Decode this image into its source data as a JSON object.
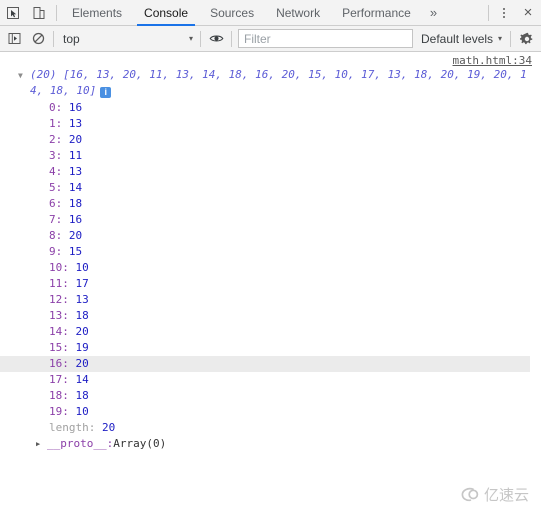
{
  "tabbar": {
    "inspect_icon": "inspect-element-icon",
    "device_icon": "device-toolbar-icon",
    "tabs": [
      {
        "label": "Elements",
        "selected": false
      },
      {
        "label": "Console",
        "selected": true
      },
      {
        "label": "Sources",
        "selected": false
      },
      {
        "label": "Network",
        "selected": false
      },
      {
        "label": "Performance",
        "selected": false
      }
    ],
    "overflow_label": "»",
    "more_icon": "more-options-icon",
    "close_label": "×"
  },
  "toolbar": {
    "sidebar_icon": "console-sidebar-icon",
    "clear_icon": "clear-console-icon",
    "context_value": "top",
    "context_caret": "▾",
    "eye_icon": "live-expression-eye-icon",
    "filter_placeholder": "Filter",
    "filter_value": "",
    "levels_label": "Default levels",
    "levels_caret": "▾",
    "gear_icon": "settings-gear-icon"
  },
  "console": {
    "source_link": "math.html:34",
    "preview": "(20) [16, 13, 20, 11, 13, 14, 18, 16, 20, 15, 10, 17, 13, 18, 20, 19, 20, 14, 18, 10]",
    "info_badge": "i",
    "properties": [
      {
        "key": "0:",
        "value": "16",
        "highlighted": false
      },
      {
        "key": "1:",
        "value": "13",
        "highlighted": false
      },
      {
        "key": "2:",
        "value": "20",
        "highlighted": false
      },
      {
        "key": "3:",
        "value": "11",
        "highlighted": false
      },
      {
        "key": "4:",
        "value": "13",
        "highlighted": false
      },
      {
        "key": "5:",
        "value": "14",
        "highlighted": false
      },
      {
        "key": "6:",
        "value": "18",
        "highlighted": false
      },
      {
        "key": "7:",
        "value": "16",
        "highlighted": false
      },
      {
        "key": "8:",
        "value": "20",
        "highlighted": false
      },
      {
        "key": "9:",
        "value": "15",
        "highlighted": false
      },
      {
        "key": "10:",
        "value": "10",
        "highlighted": false
      },
      {
        "key": "11:",
        "value": "17",
        "highlighted": false
      },
      {
        "key": "12:",
        "value": "13",
        "highlighted": false
      },
      {
        "key": "13:",
        "value": "18",
        "highlighted": false
      },
      {
        "key": "14:",
        "value": "20",
        "highlighted": false
      },
      {
        "key": "15:",
        "value": "19",
        "highlighted": false
      },
      {
        "key": "16:",
        "value": "20",
        "highlighted": true
      },
      {
        "key": "17:",
        "value": "14",
        "highlighted": false
      },
      {
        "key": "18:",
        "value": "18",
        "highlighted": false
      },
      {
        "key": "19:",
        "value": "10",
        "highlighted": false
      }
    ],
    "length_key": "length:",
    "length_value": "20",
    "proto_key": "__proto__:",
    "proto_value": "Array(0)",
    "prompt_chevron": "❯"
  },
  "watermark": {
    "text": "亿速云"
  },
  "colors": {
    "accent": "#1a73e8",
    "chrome_bg": "#f3f3f3",
    "key_purple": "#8b3fa8",
    "value_blue": "#1d1dc4",
    "preview_blue": "#5c5cd6",
    "highlight_row": "#ebebeb",
    "info_badge": "#4a90e2"
  }
}
